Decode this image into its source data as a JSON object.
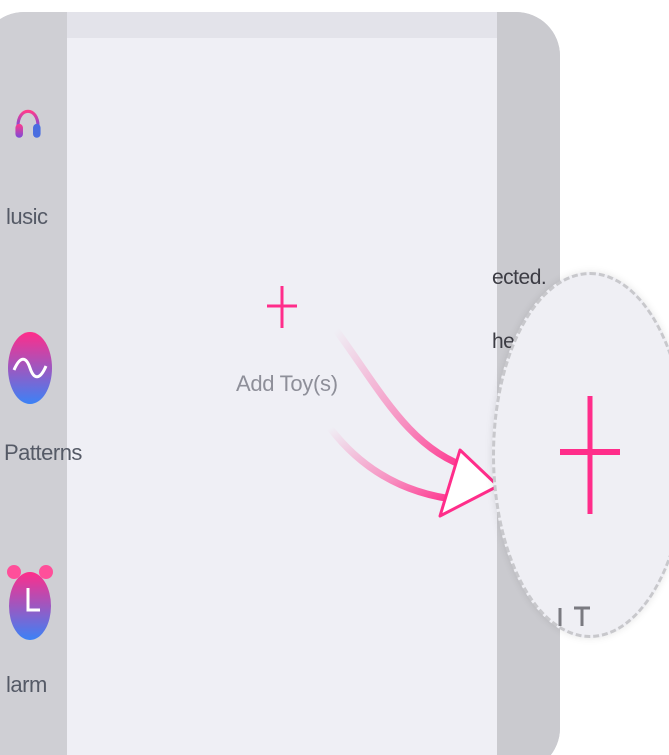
{
  "sidebar": {
    "items": [
      {
        "label": "Music",
        "display": "lusic",
        "icon": "headphones-icon"
      },
      {
        "label": "Patterns",
        "display": "Patterns",
        "icon": "wave-icon"
      },
      {
        "label": "Alarm",
        "display": "larm",
        "icon": "alarm-clock-icon"
      }
    ]
  },
  "main": {
    "add_toy_label": "Add Toy(s)",
    "add_icon": "plus-icon"
  },
  "background_text": {
    "line1": "ected.",
    "line2": "he"
  },
  "zoom": {
    "icon": "plus-icon"
  },
  "colors": {
    "accent": "#ff2d8a",
    "gradient_start": "#ff2d8a",
    "gradient_end": "#3b82f6",
    "content_bg": "#efeff5",
    "frame_bg": "#cfcfd4"
  }
}
